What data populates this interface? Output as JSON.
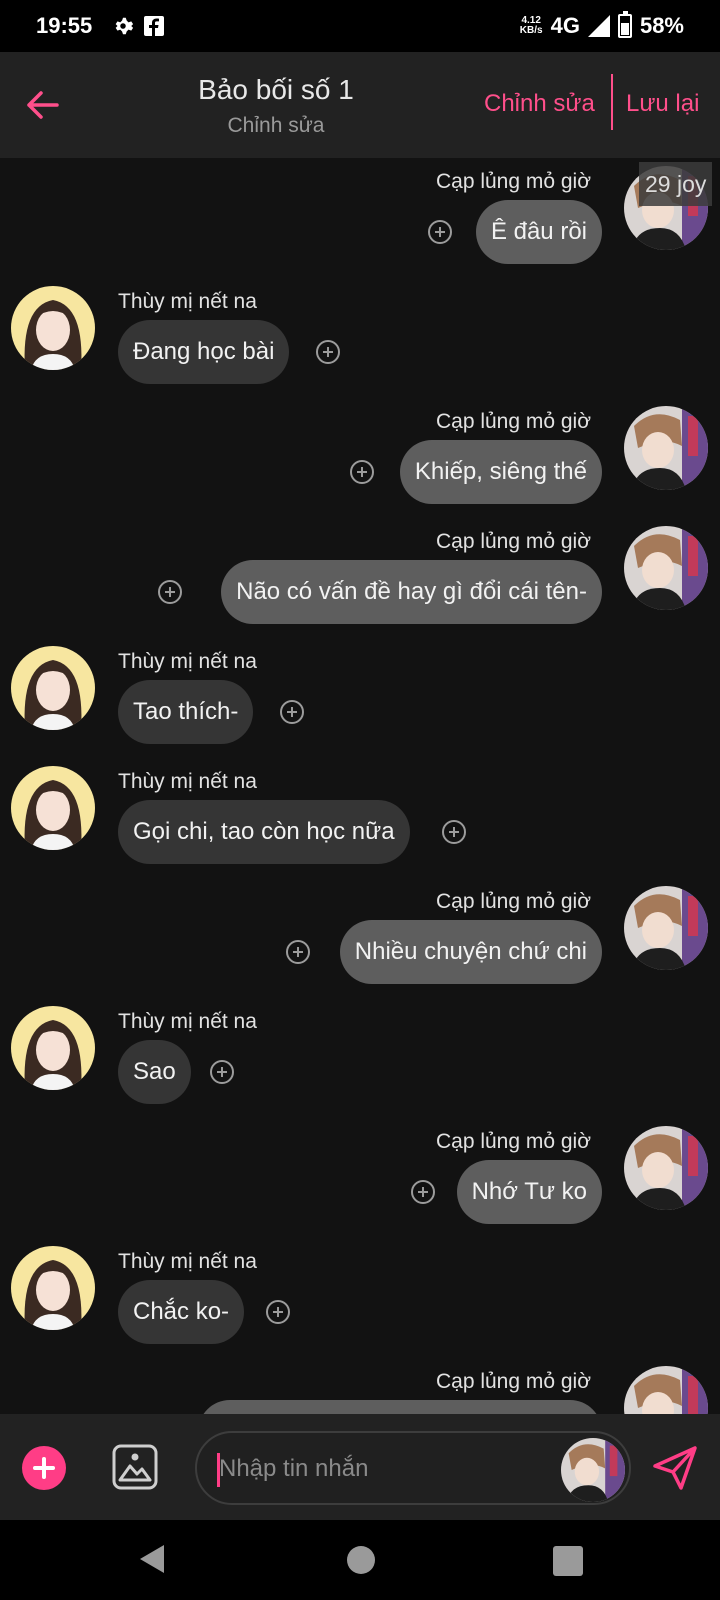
{
  "status": {
    "time": "19:55",
    "net_speed_top": "4.12",
    "net_speed_bottom": "KB/s",
    "network": "4G",
    "battery": "58%"
  },
  "header": {
    "title": "Bảo bối số 1",
    "subtitle": "Chỉnh sửa",
    "edit_label": "Chỉnh sửa",
    "save_label": "Lưu lại"
  },
  "chat": {
    "corner_tag": "29 joy",
    "messages": [
      {
        "side": "right",
        "name": "Cạp lủng mỏ giờ",
        "text": "Ê đâu rồi"
      },
      {
        "side": "left",
        "name": "Thùy mị nết na",
        "text": "Đang học bài"
      },
      {
        "side": "right",
        "name": "Cạp lủng mỏ giờ",
        "text": "Khiếp, siêng thế"
      },
      {
        "side": "right",
        "name": "Cạp lủng mỏ giờ",
        "text": "Não có vấn đề hay gì đổi cái tên-"
      },
      {
        "side": "left",
        "name": "Thùy mị nết na",
        "text": "Tao thích-"
      },
      {
        "side": "left",
        "name": "Thùy mị nết na",
        "text": "Gọi chi, tao còn học nữa"
      },
      {
        "side": "right",
        "name": "Cạp lủng mỏ giờ",
        "text": "Nhiều chuyện chứ chi"
      },
      {
        "side": "left",
        "name": "Thùy mị nết na",
        "text": "Sao"
      },
      {
        "side": "right",
        "name": "Cạp lủng mỏ giờ",
        "text": "Nhớ Tư ko"
      },
      {
        "side": "left",
        "name": "Thùy mị nết na",
        "text": "Chắc ko-"
      },
      {
        "side": "right",
        "name": "Cạp lủng mỏ giờ",
        "text": ""
      }
    ]
  },
  "input": {
    "placeholder": "Nhập tin nhắn"
  },
  "icons": {
    "back": "arrow-left-icon",
    "add": "plus-circle-icon",
    "image": "image-icon",
    "send": "send-icon"
  },
  "colors": {
    "accent": "#ff4f8b",
    "header_bg": "#222222",
    "chat_bg": "#121212",
    "bubble_left": "#353535",
    "bubble_right": "#5e5e5e"
  }
}
